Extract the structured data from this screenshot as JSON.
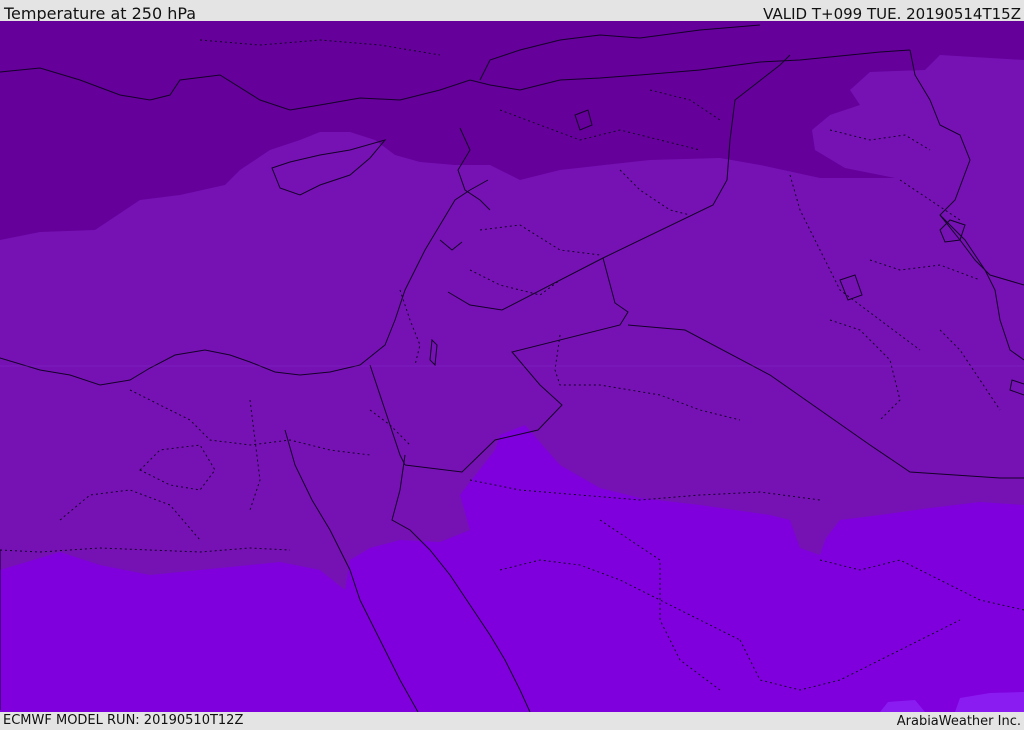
{
  "header": {
    "title": "Temperature at 250 hPa",
    "valid_time": "VALID T+099 TUE. 20190514T15Z"
  },
  "footer": {
    "model_run": "ECMWF MODEL RUN: 20190510T12Z",
    "credit": "ArabiaWeather Inc."
  },
  "map": {
    "field": "Temperature",
    "level": "250 hPa",
    "colors": {
      "coldest_band": "#65009a",
      "middle_band": "#7612b4",
      "warm_band": "#7f00dc",
      "warmest_patch": "#8a1cf2",
      "border_line": "#140028"
    }
  }
}
